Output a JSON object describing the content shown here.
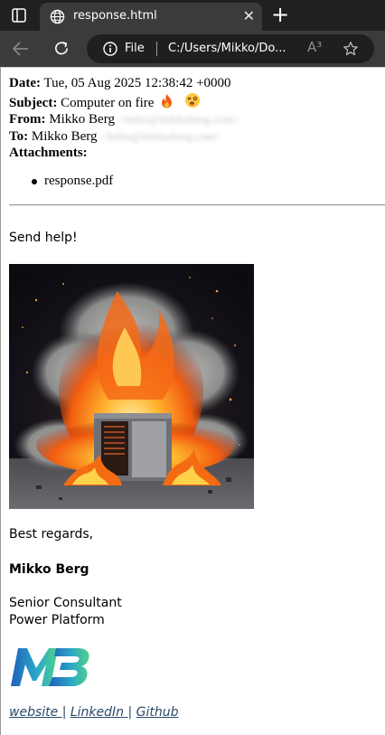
{
  "browser": {
    "tab_title": "response.html",
    "tab_close": "✕",
    "new_tab": "+",
    "site_info_label": "File",
    "url": "C:/Users/Mikko/Do...",
    "read_aloud": "A³"
  },
  "email": {
    "date_label": "Date:",
    "date_value": "Tue, 05 Aug 2025 12:38:42 +0000",
    "subject_label": "Subject:",
    "subject_value": "Computer on fire",
    "from_label": "From:",
    "from_name": "Mikko Berg",
    "from_email_blurred": "<hello@mikkoberg.com>",
    "to_label": "To:",
    "to_name": "Mikko Berg",
    "to_email_blurred": "<hello@mikkoberg.com>",
    "attachments_label": "Attachments:",
    "attachments": [
      "response.pdf"
    ]
  },
  "message": {
    "greeting": "Send help!",
    "closing": "Best regards,",
    "signature_name": "Mikko Berg",
    "signature_title": "Senior Consultant",
    "signature_team": "Power Platform",
    "links": {
      "website": "website ",
      "linkedin": "LinkedIn ",
      "github": "Github",
      "separator": "|"
    }
  },
  "colors": {
    "chrome_dark": "#202020",
    "chrome_tab": "#3b3b3b",
    "link": "#2a4a6b",
    "logo_start": "#1f5fb8",
    "logo_end": "#4fd18b"
  },
  "icons": {
    "sidebar": "tab-actions-icon",
    "tab_favicon": "globe-icon",
    "back": "arrow-left-icon",
    "reload": "reload-icon",
    "info": "info-icon",
    "favorite": "star-icon",
    "subject_emoji_1": "fire-emoji",
    "subject_emoji_2": "dizzy-face-emoji"
  }
}
